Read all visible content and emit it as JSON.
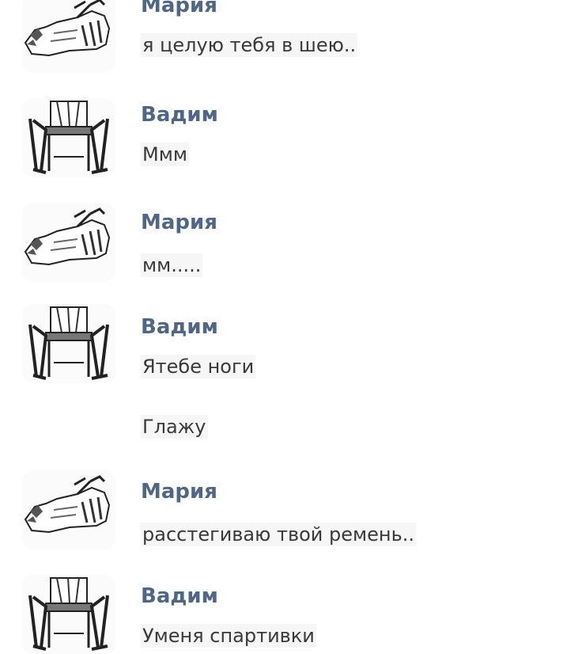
{
  "messages": [
    {
      "author": "Мария",
      "text": "я целую тебя в шею..",
      "avatar": "lying-figure-icon"
    },
    {
      "author": "Вадим",
      "text": "Ммм",
      "avatar": "chair-figure-icon"
    },
    {
      "author": "Мария",
      "text": "мм.....",
      "avatar": "lying-figure-icon"
    },
    {
      "author": "Вадим",
      "text": "Ятебе ноги",
      "avatar": "chair-figure-icon"
    },
    {
      "text": "Глажу"
    },
    {
      "author": "Мария",
      "text": "расстегиваю твой ремень..",
      "avatar": "lying-figure-icon"
    },
    {
      "author": "Вадим",
      "text": "Уменя спартивки",
      "avatar": "chair-figure-icon"
    }
  ],
  "colors": {
    "author_name": "#4f6684",
    "message_text": "#3a3a3a",
    "background": "#ffffff"
  }
}
